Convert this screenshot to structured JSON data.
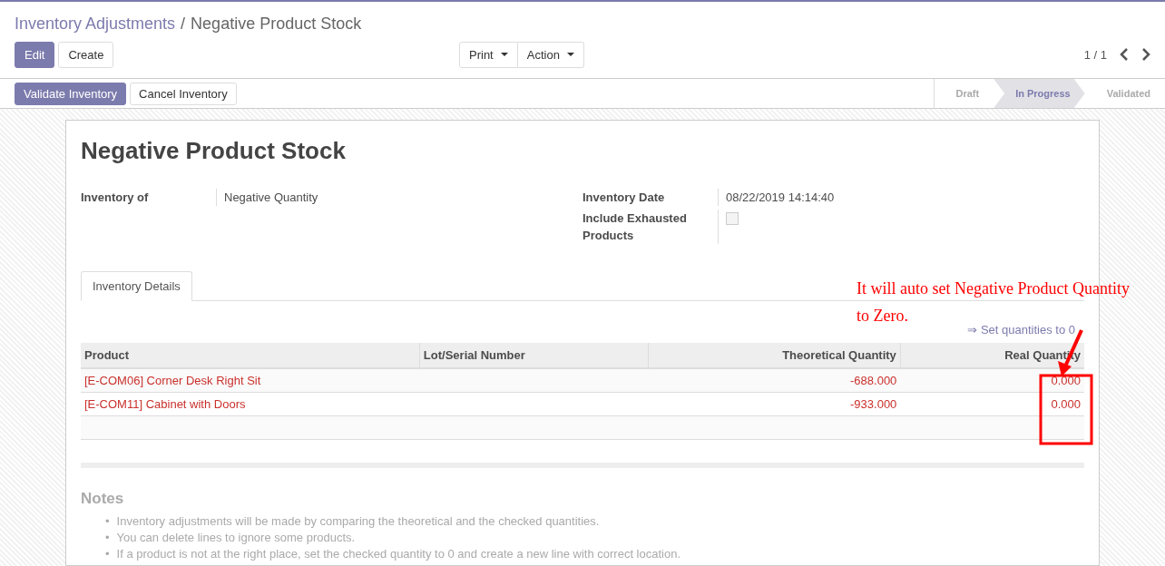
{
  "breadcrumb": {
    "parent": "Inventory Adjustments",
    "separator": "/",
    "current": "Negative Product Stock"
  },
  "buttons": [
    {
      "label": "Edit",
      "kind": "primary"
    },
    {
      "label": "Create",
      "kind": "secondary"
    }
  ],
  "dropdowns": [
    "Print",
    "Action"
  ],
  "pager": "1 / 1",
  "status_buttons": [
    {
      "label": "Validate Inventory",
      "kind": "primary"
    },
    {
      "label": "Cancel Inventory",
      "kind": "secondary"
    }
  ],
  "status_steps": [
    {
      "label": "Draft",
      "selected": false
    },
    {
      "label": "In Progress",
      "selected": true
    },
    {
      "label": "Validated",
      "selected": false
    }
  ],
  "title": "Negative Product Stock",
  "left_fields": [
    {
      "label": "Inventory of",
      "value": "Negative Quantity"
    }
  ],
  "right_fields": [
    {
      "label": "Inventory Date",
      "kind": "text",
      "value": "08/22/2019 14:14:40"
    },
    {
      "label": "Include Exhausted Products",
      "kind": "checkbox",
      "checked": false
    }
  ],
  "tabs": [
    {
      "label": "Inventory Details",
      "selected": true
    }
  ],
  "set_link": "⇒ Set quantities to 0",
  "table": {
    "columns": [
      "Product",
      "Lot/Serial Number",
      "Theoretical Quantity",
      "Real Quantity"
    ],
    "rows": [
      [
        "[E-COM06] Corner Desk Right Sit",
        "",
        "-688.000",
        "0.000"
      ],
      [
        "[E-COM11] Cabinet with Doors",
        "",
        "-933.000",
        "0.000"
      ]
    ]
  },
  "notes": {
    "title": "Notes",
    "bullet": "•",
    "items": [
      "Inventory adjustments will be made by comparing the theoretical and the checked quantities.",
      "You can delete lines to ignore some products.",
      "If a product is not at the right place, set the checked quantity to 0 and create a new line with correct location."
    ]
  },
  "annotation": "It will auto set Negative Product Quantity to Zero."
}
